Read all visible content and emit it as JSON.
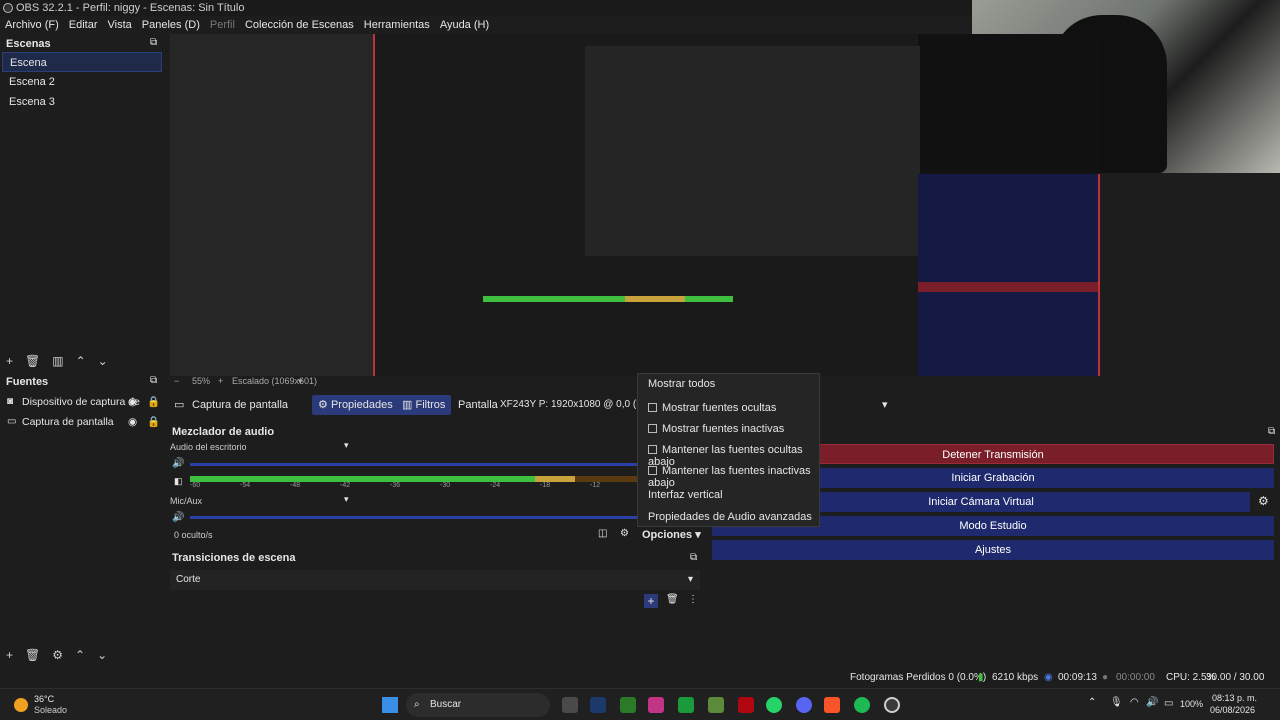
{
  "window": {
    "title": "OBS 32.2.1 - Perfil: niggy - Escenas: Sin Título"
  },
  "menu": [
    "Archivo (F)",
    "Editar",
    "Vista",
    "Paneles (D)",
    "Perfil",
    "Colección de Escenas",
    "Herramientas",
    "Ayuda (H)"
  ],
  "scenes": {
    "title": "Escenas",
    "items": [
      "Escena",
      "Escena 2",
      "Escena 3"
    ],
    "selected": 0
  },
  "sources": {
    "title": "Fuentes",
    "items": [
      "Dispositivo de captura de",
      "Captura de pantalla"
    ],
    "selected": 1
  },
  "preview": {
    "zoom_label": "55%",
    "scale_label": "Escalado (1069x601)"
  },
  "source_toolbar": {
    "source_name": "Captura de pantalla",
    "properties": "Propiedades",
    "filters": "Filtros",
    "display_label": "Pantalla",
    "display_value": "XF243Y P: 1920x1080 @ 0,0 (Monito"
  },
  "mixer": {
    "title": "Mezclador de audio",
    "channels": [
      {
        "name": "Audio del escritorio",
        "level": 0.78
      },
      {
        "name": "Mic/Aux",
        "level": 0.0
      }
    ],
    "ticks": [
      "-60",
      "-54",
      "-48",
      "-42",
      "-36",
      "-30",
      "-24",
      "-18",
      "-12"
    ],
    "hidden_count": "0 oculto/s",
    "options": "Opciones"
  },
  "transitions": {
    "title": "Transiciones de escena",
    "selected": "Corte"
  },
  "controls": {
    "buttons": [
      "Detener Transmisión",
      "Iniciar Grabación",
      "Iniciar Cámara Virtual",
      "Modo Estudio",
      "Ajustes"
    ]
  },
  "options_menu": {
    "items": [
      {
        "label": "Mostrar todos",
        "checkbox": false
      },
      {
        "label": "Mostrar fuentes ocultas",
        "checkbox": true
      },
      {
        "label": "Mostrar fuentes inactivas",
        "checkbox": true
      },
      {
        "label": "Mantener las fuentes ocultas abajo",
        "checkbox": true
      },
      {
        "label": "Mantener las fuentes inactivas abajo",
        "checkbox": true
      },
      {
        "label": "Interfaz vertical",
        "checkbox": false
      },
      {
        "label": "Propiedades de Audio avanzadas",
        "checkbox": false
      }
    ]
  },
  "status": {
    "dropped_frames": "Fotogramas Perdidos 0 (0.0%)",
    "bitrate": "6210 kbps",
    "stream_time": "00:09:13",
    "rec_time": "00:00:00",
    "cpu": "CPU: 2.5%",
    "fps": "30.00 / 30.00 FPS"
  },
  "taskbar": {
    "weather_temp": "36°C",
    "weather_desc": "Soleado",
    "search_placeholder": "Buscar",
    "battery": "100%",
    "time": "08:13 p. m.",
    "date": "06/08/2026"
  },
  "colors": {
    "accent_blue": "#1f2a6e",
    "stream_red": "#7a1e2a",
    "meter_green": "#3fbf3f",
    "meter_yellow": "#c8a23a"
  }
}
